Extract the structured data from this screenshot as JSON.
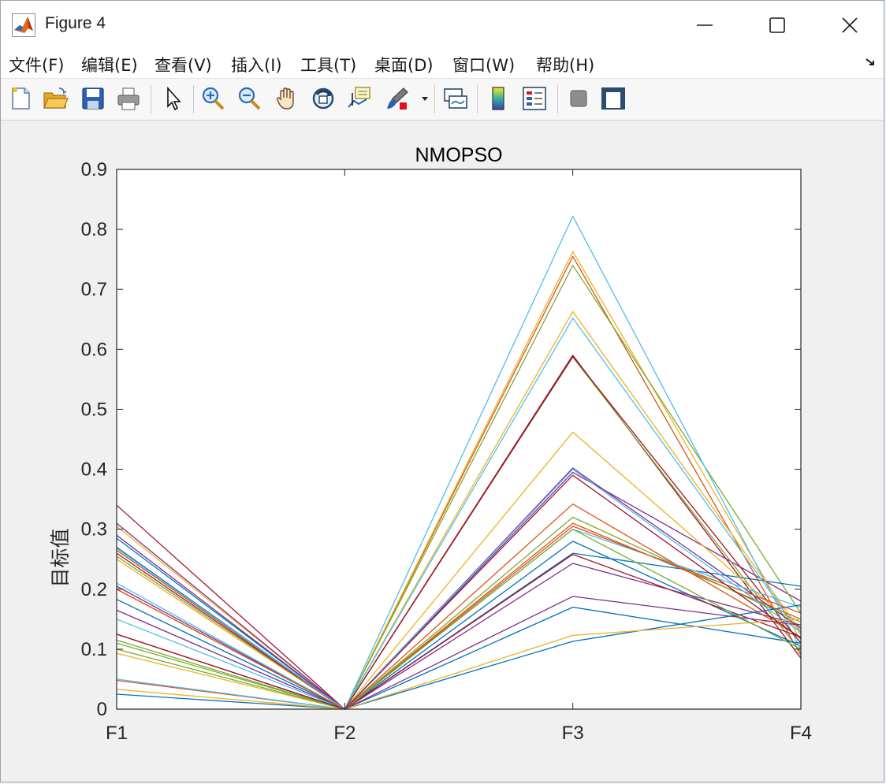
{
  "window": {
    "title": "Figure 4"
  },
  "menu": [
    "文件(F)",
    "编辑(E)",
    "查看(V)",
    "插入(I)",
    "工具(T)",
    "桌面(D)",
    "窗口(W)",
    "帮助(H)"
  ],
  "toolbar": {
    "icons": [
      "new-figure-icon",
      "open-file-icon",
      "save-icon",
      "print-icon",
      "select-arrow-icon",
      "zoom-in-icon",
      "zoom-out-icon",
      "pan-hand-icon",
      "rotate-3d-icon",
      "data-cursor-icon",
      "brush-icon",
      "link-plot-icon",
      "colorbar-icon",
      "legend-icon",
      "hide-plot-tools-icon",
      "show-plot-tools-icon"
    ]
  },
  "colors": {
    "matlab_order": [
      "#0072BD",
      "#D95319",
      "#EDB120",
      "#7E2F8E",
      "#77AC30",
      "#4DBEEE",
      "#A2142F"
    ],
    "axes": "#262626"
  },
  "chart_data": {
    "type": "line",
    "subtype": "parallel-coordinates",
    "title": "NMOPSO",
    "xlabel": "",
    "ylabel": "目标值",
    "categories": [
      "F1",
      "F2",
      "F3",
      "F4"
    ],
    "ylim": [
      0,
      0.9
    ],
    "yticks": [
      "0",
      "0.1",
      "0.2",
      "0.3",
      "0.4",
      "0.5",
      "0.6",
      "0.7",
      "0.8",
      "0.9"
    ],
    "grid": false,
    "box": true,
    "series": [
      {
        "color": "#0072BD",
        "values": [
          0.285,
          0.0,
          0.28,
          0.105
        ]
      },
      {
        "color": "#D95319",
        "values": [
          0.265,
          0.0,
          0.755,
          0.09
        ]
      },
      {
        "color": "#EDB120",
        "values": [
          0.305,
          0.0,
          0.763,
          0.115
        ]
      },
      {
        "color": "#7E2F8E",
        "values": [
          0.205,
          0.0,
          0.395,
          0.18
        ]
      },
      {
        "color": "#77AC30",
        "values": [
          0.255,
          0.0,
          0.74,
          0.16
        ]
      },
      {
        "color": "#4DBEEE",
        "values": [
          0.21,
          0.0,
          0.822,
          0.1
        ]
      },
      {
        "color": "#A2142F",
        "values": [
          0.34,
          0.0,
          0.59,
          0.085
        ]
      },
      {
        "color": "#0072BD",
        "values": [
          0.27,
          0.0,
          0.26,
          0.205
        ]
      },
      {
        "color": "#D95319",
        "values": [
          0.2,
          0.0,
          0.342,
          0.12
        ]
      },
      {
        "color": "#EDB120",
        "values": [
          0.25,
          0.0,
          0.663,
          0.13
        ]
      },
      {
        "color": "#7E2F8E",
        "values": [
          0.165,
          0.0,
          0.243,
          0.14
        ]
      },
      {
        "color": "#77AC30",
        "values": [
          0.115,
          0.0,
          0.587,
          0.095
        ]
      },
      {
        "color": "#4DBEEE",
        "values": [
          0.15,
          0.0,
          0.652,
          0.125
        ]
      },
      {
        "color": "#A2142F",
        "values": [
          0.125,
          0.0,
          0.588,
          0.11
        ]
      },
      {
        "color": "#0072BD",
        "values": [
          0.183,
          0.0,
          0.17,
          0.11
        ]
      },
      {
        "color": "#D95319",
        "values": [
          0.048,
          0.0,
          0.31,
          0.15
        ]
      },
      {
        "color": "#EDB120",
        "values": [
          0.093,
          0.0,
          0.462,
          0.13
        ]
      },
      {
        "color": "#7E2F8E",
        "values": [
          0.31,
          0.0,
          0.402,
          0.135
        ]
      },
      {
        "color": "#77AC30",
        "values": [
          0.11,
          0.0,
          0.32,
          0.145
        ]
      },
      {
        "color": "#4DBEEE",
        "values": [
          0.05,
          0.0,
          0.3,
          0.17
        ]
      },
      {
        "color": "#A2142F",
        "values": [
          0.26,
          0.0,
          0.258,
          0.12
        ]
      },
      {
        "color": "#0072BD",
        "values": [
          0.025,
          0.0,
          0.113,
          0.174
        ]
      },
      {
        "color": "#D95319",
        "values": [
          0.2,
          0.0,
          0.305,
          0.16
        ]
      },
      {
        "color": "#EDB120",
        "values": [
          0.033,
          0.0,
          0.123,
          0.15
        ]
      },
      {
        "color": "#7E2F8E",
        "values": [
          0.29,
          0.0,
          0.188,
          0.14
        ]
      },
      {
        "color": "#77AC30",
        "values": [
          0.1,
          0.0,
          0.3,
          0.1
        ]
      },
      {
        "color": "#4DBEEE",
        "values": [
          0.268,
          0.0,
          0.4,
          0.128
        ]
      },
      {
        "color": "#A2142F",
        "values": [
          0.125,
          0.0,
          0.39,
          0.118
        ]
      }
    ]
  }
}
